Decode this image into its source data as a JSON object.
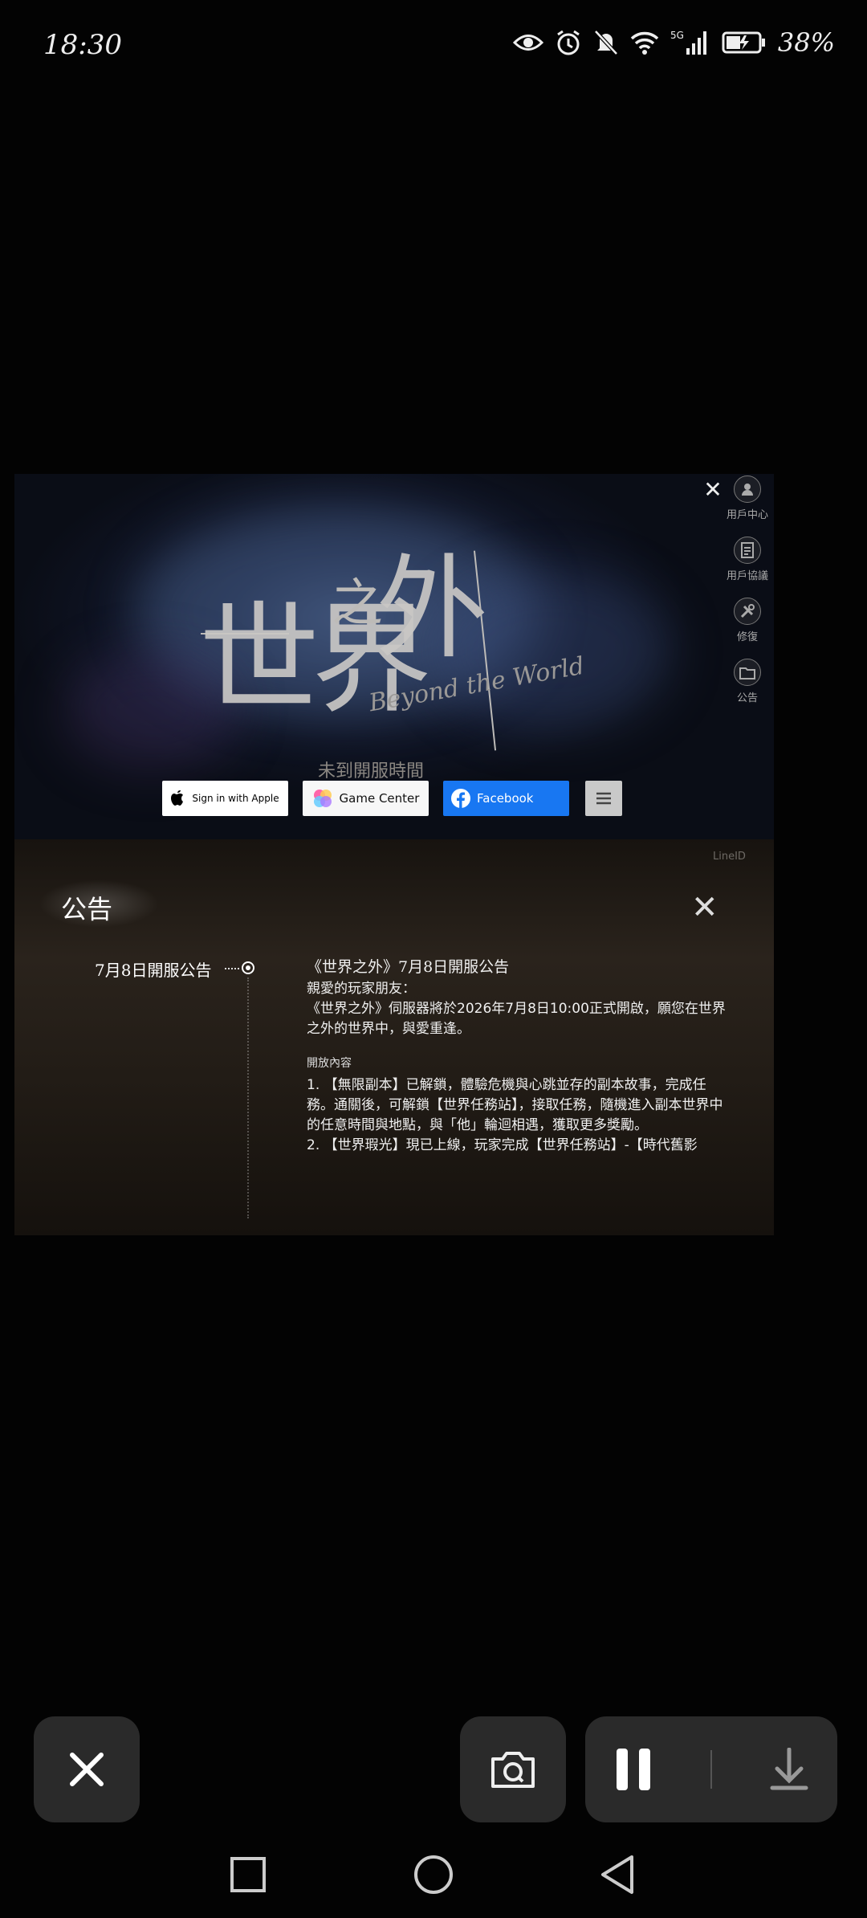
{
  "status_bar": {
    "time": "18:30",
    "battery": "38%",
    "network": "5G"
  },
  "game": {
    "logo_main": "世界",
    "logo_small": "之",
    "logo_big": "外",
    "logo_script": "Beyond the World",
    "unopened_label": "未到開服時間",
    "side_menu": [
      {
        "label": "用戶中心",
        "icon": "user-icon"
      },
      {
        "label": "用戶協議",
        "icon": "document-icon"
      },
      {
        "label": "修復",
        "icon": "wrench-icon"
      },
      {
        "label": "公告",
        "icon": "folder-icon"
      }
    ],
    "login": {
      "apple": "Sign in with Apple",
      "gamecenter": "Game Center",
      "facebook": "Facebook"
    },
    "notice": {
      "title": "公告",
      "line_id": "LineID",
      "tab": "7月8日開服公告",
      "heading": "《世界之外》7月8日開服公告",
      "greeting": "親愛的玩家朋友：",
      "intro": "《世界之外》伺服器將於2026年7月8日10:00正式開啟，願您在世界之外的世界中，與愛重逢。",
      "section_title": "開放內容",
      "item1": "1. 【無限副本】已解鎖，體驗危機與心跳並存的副本故事，完成任務。通關後，可解鎖【世界任務站】，接取任務，隨機進入副本世界中的任意時間與地點，與「他」輪迴相遇，獲取更多獎勵。",
      "item2": "2. 【世界瑕光】現已上線，玩家完成【世界任務站】-【時代舊影"
    }
  }
}
